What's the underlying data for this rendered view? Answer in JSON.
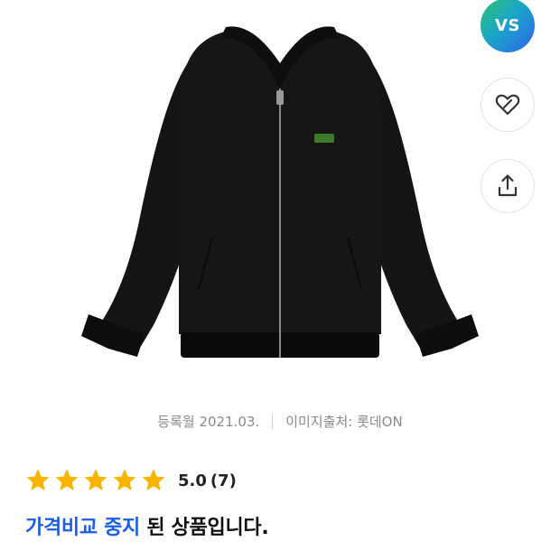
{
  "product": {
    "image_alt": "black bomber jacket with zipper and small green crocodile logo"
  },
  "actions": {
    "vs_label": "VS",
    "like_icon": "heart-link-icon",
    "share_icon": "share-icon"
  },
  "meta": {
    "registered": "등록월 2021.03.",
    "image_source": "이미지출처: 롯데ON"
  },
  "rating": {
    "stars": 5,
    "max": 5,
    "score": "5.0",
    "count": "(7)",
    "star_color": "#f7b500"
  },
  "status": {
    "highlight": "가격비교 중지",
    "rest": " 된 상품입니다.",
    "highlight_color": "#1b5ee6"
  },
  "colors": {
    "vs_gradient": [
      "#2ec26a",
      "#1aa6c9",
      "#2d63e8"
    ]
  }
}
